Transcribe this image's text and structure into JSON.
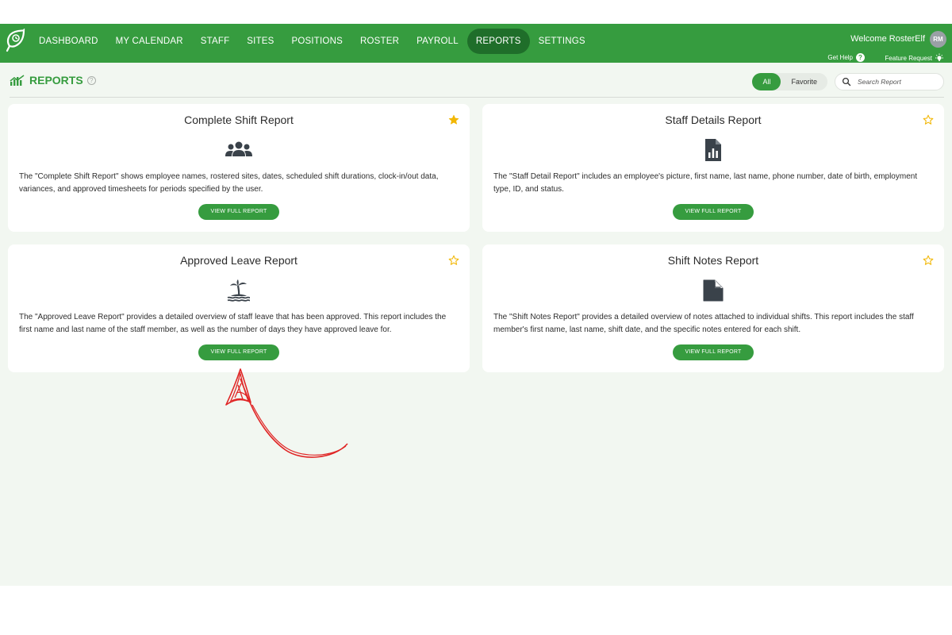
{
  "nav": {
    "items": [
      "DASHBOARD",
      "MY CALENDAR",
      "STAFF",
      "SITES",
      "POSITIONS",
      "ROSTER",
      "PAYROLL",
      "REPORTS",
      "SETTINGS"
    ],
    "active": "REPORTS"
  },
  "user": {
    "welcome": "Welcome RosterElf",
    "initials": "RM"
  },
  "help": {
    "get_help": "Get Help",
    "feature_request": "Feature Request"
  },
  "page": {
    "title": "REPORTS",
    "help_mark": "?",
    "filter_all": "All",
    "filter_favorite": "Favorite",
    "search_placeholder": "Search Report"
  },
  "colors": {
    "brand": "#369c3f",
    "brand_dark": "#1f6e2a",
    "star": "#f2b705",
    "icon": "#3a424a",
    "annotation": "#e02626"
  },
  "reports": [
    {
      "title": "Complete Shift Report",
      "icon": "users-icon",
      "favorite": true,
      "description": "The \"Complete Shift Report\" shows employee names, rostered sites, dates, scheduled shift durations, clock-in/out data, variances, and approved timesheets for periods specified by the user.",
      "button": "VIEW FULL REPORT"
    },
    {
      "title": "Staff Details Report",
      "icon": "file-chart-icon",
      "favorite": false,
      "description": "The \"Staff Detail Report\" includes an employee's picture, first name, last name, phone number, date of birth, employment type, ID, and status.",
      "button": "VIEW FULL REPORT"
    },
    {
      "title": "Approved Leave Report",
      "icon": "island-icon",
      "favorite": false,
      "description": "The \"Approved Leave Report\" provides a detailed overview of staff leave that has been approved. This report includes the first name and last name of the staff member, as well as the number of days they have approved leave for.",
      "button": "VIEW FULL REPORT"
    },
    {
      "title": "Shift Notes Report",
      "icon": "file-icon",
      "favorite": false,
      "description": "The \"Shift Notes Report\" provides a detailed overview of notes attached to individual shifts. This report includes the staff member's first name, last name, shift date, and the specific notes entered for each shift.",
      "button": "VIEW FULL REPORT"
    }
  ]
}
